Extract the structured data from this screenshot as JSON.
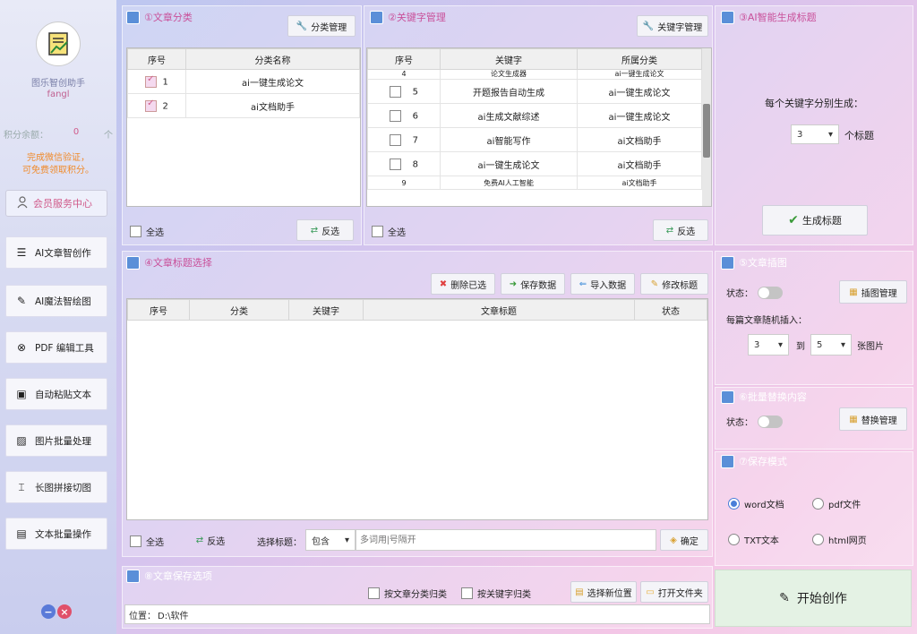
{
  "sidebar": {
    "app_name": "图乐智创助手",
    "username": "fangl",
    "points_label": "积分余额：",
    "points_value": "0",
    "points_unit": "个",
    "promo_line1": "完成微信验证，",
    "promo_line2": "可免费领取积分。",
    "member_label": "会员服务中心",
    "nav": [
      {
        "label": "AI文章智创作",
        "icon": "article-icon"
      },
      {
        "label": "AI魔法智绘图",
        "icon": "magic-draw-icon"
      },
      {
        "label": "PDF 编辑工具",
        "icon": "pdf-icon"
      },
      {
        "label": "自动粘贴文本",
        "icon": "paste-icon"
      },
      {
        "label": "图片批量处理",
        "icon": "image-batch-icon"
      },
      {
        "label": "长图拼接切图",
        "icon": "long-image-icon"
      },
      {
        "label": "文本批量操作",
        "icon": "text-batch-icon"
      }
    ]
  },
  "category_panel": {
    "title": "①文章分类",
    "manage_btn": "分类管理",
    "columns": [
      "序号",
      "分类名称"
    ],
    "rows": [
      {
        "index": "1",
        "name": "ai一键生成论文",
        "checked": true
      },
      {
        "index": "2",
        "name": "ai文档助手",
        "checked": true
      }
    ],
    "select_all": "全选",
    "invert": "反选"
  },
  "keyword_panel": {
    "title": "②关键字管理",
    "manage_btn": "关键字管理",
    "columns": [
      "序号",
      "关键字",
      "所属分类"
    ],
    "rows": [
      {
        "index": "4",
        "keyword": "论文生成器",
        "category": "ai一键生成论文"
      },
      {
        "index": "5",
        "keyword": "开题报告自动生成",
        "category": "ai一键生成论文"
      },
      {
        "index": "6",
        "keyword": "ai生成文献综述",
        "category": "ai一键生成论文"
      },
      {
        "index": "7",
        "keyword": "ai智能写作",
        "category": "ai文档助手"
      },
      {
        "index": "8",
        "keyword": "ai一键生成论文",
        "category": "ai文档助手"
      },
      {
        "index": "9",
        "keyword": "免费AI人工智能",
        "category": "ai文档助手"
      }
    ],
    "select_all": "全选",
    "invert": "反选"
  },
  "title_gen_panel": {
    "title": "③AI智能生成标题",
    "each_keyword_label": "每个关键字分别生成：",
    "count_value": "3",
    "count_unit": "个标题",
    "generate_btn": "生成标题"
  },
  "title_select_panel": {
    "title": "④文章标题选择",
    "delete_btn": "删除已选",
    "save_btn": "保存数据",
    "import_btn": "导入数据",
    "edit_btn": "修改标题",
    "columns": [
      "序号",
      "分类",
      "关键字",
      "文章标题",
      "状态"
    ],
    "select_all": "全选",
    "invert": "反选",
    "filter_label": "选择标题：",
    "filter_mode": "包含",
    "filter_placeholder": "多词用|号隔开",
    "confirm_btn": "确定"
  },
  "illustration_panel": {
    "title": "⑤文章插图",
    "status_label": "状态：",
    "manage_btn": "插图管理",
    "random_label": "每篇文章随机插入：",
    "min_value": "3",
    "to_label": "到",
    "max_value": "5",
    "unit": "张图片"
  },
  "replace_panel": {
    "title": "⑥批量替换内容",
    "status_label": "状态：",
    "manage_btn": "替换管理"
  },
  "save_format_panel": {
    "title": "⑦保存模式",
    "options": [
      {
        "label": "word文档",
        "selected": true
      },
      {
        "label": "pdf文件",
        "selected": false
      },
      {
        "label": "TXT文本",
        "selected": false
      },
      {
        "label": "html网页",
        "selected": false
      }
    ]
  },
  "save_options_panel": {
    "title": "⑧文章保存选项",
    "by_category": "按文章分类归类",
    "by_keyword": "按关键字归类",
    "choose_location_btn": "选择新位置",
    "open_folder_btn": "打开文件夹",
    "location_label": "位置：",
    "location_value": "D:\\软件"
  },
  "start_btn": "开始创作"
}
